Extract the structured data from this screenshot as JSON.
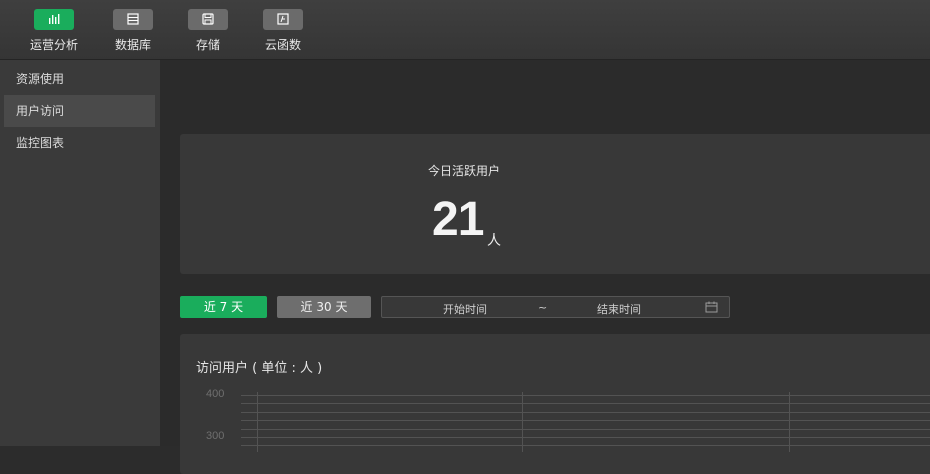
{
  "toolbar": {
    "items": [
      {
        "label": "运营分析",
        "icon": "bar-chart-icon",
        "active": true
      },
      {
        "label": "数据库",
        "icon": "database-icon",
        "active": false
      },
      {
        "label": "存储",
        "icon": "storage-icon",
        "active": false
      },
      {
        "label": "云函数",
        "icon": "cloud-function-icon",
        "active": false
      }
    ]
  },
  "sidebar": {
    "items": [
      {
        "label": "资源使用",
        "active": false
      },
      {
        "label": "用户访问",
        "active": true
      },
      {
        "label": "监控图表",
        "active": false
      }
    ]
  },
  "stats": {
    "title": "今日活跃用户",
    "value": "21",
    "unit": "人"
  },
  "filters": {
    "last7": "近 7 天",
    "last30": "近 30 天",
    "start_placeholder": "开始时间",
    "separator": "~",
    "end_placeholder": "结束时间"
  },
  "chart": {
    "title": "访问用户 ( 单位 : 人 )"
  },
  "chart_data": {
    "type": "line",
    "title": "访问用户 ( 单位 : 人 )",
    "y_ticks": [
      "400",
      "300"
    ],
    "series": []
  },
  "colors": {
    "accent": "#1aad5c",
    "panel": "#383838",
    "background": "#2b2b2b"
  }
}
